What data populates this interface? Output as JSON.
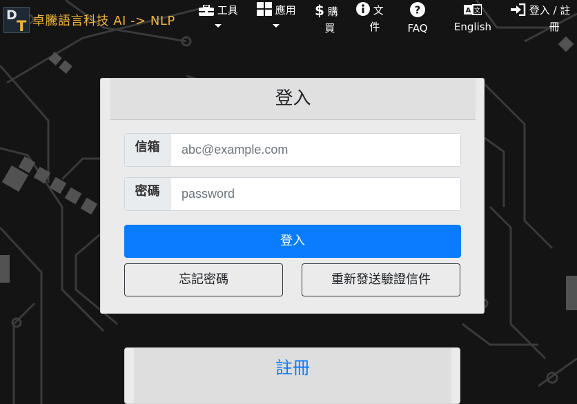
{
  "brand": {
    "logo_d": "D",
    "logo_t": "T",
    "title": "卓騰語言科技 AI -> NLP"
  },
  "nav": {
    "tools": {
      "line1": "工具",
      "icon": "toolbox-icon"
    },
    "apps": {
      "line1": "應用",
      "icon": "grid-icon"
    },
    "purchase": {
      "line1": "購",
      "line2": "買",
      "icon": "dollar-icon"
    },
    "docs": {
      "line1": "文",
      "line2": "件",
      "icon": "info-icon"
    },
    "faq": {
      "label": "FAQ",
      "icon": "question-icon"
    },
    "language": {
      "label": "English",
      "icon": "translate-icon"
    },
    "auth": {
      "line1": "登入 / 註",
      "line2": "冊",
      "icon": "sign-in-icon"
    }
  },
  "login": {
    "title": "登入",
    "email_label": "信箱",
    "email_placeholder": "abc@example.com",
    "password_label": "密碼",
    "password_placeholder": "password",
    "submit_label": "登入",
    "forgot_label": "忘記密碼",
    "resend_label": "重新發送驗證信件"
  },
  "register": {
    "label": "註冊"
  },
  "colors": {
    "primary": "#0a7cff",
    "brand": "#f0b43a",
    "background": "#141414"
  }
}
